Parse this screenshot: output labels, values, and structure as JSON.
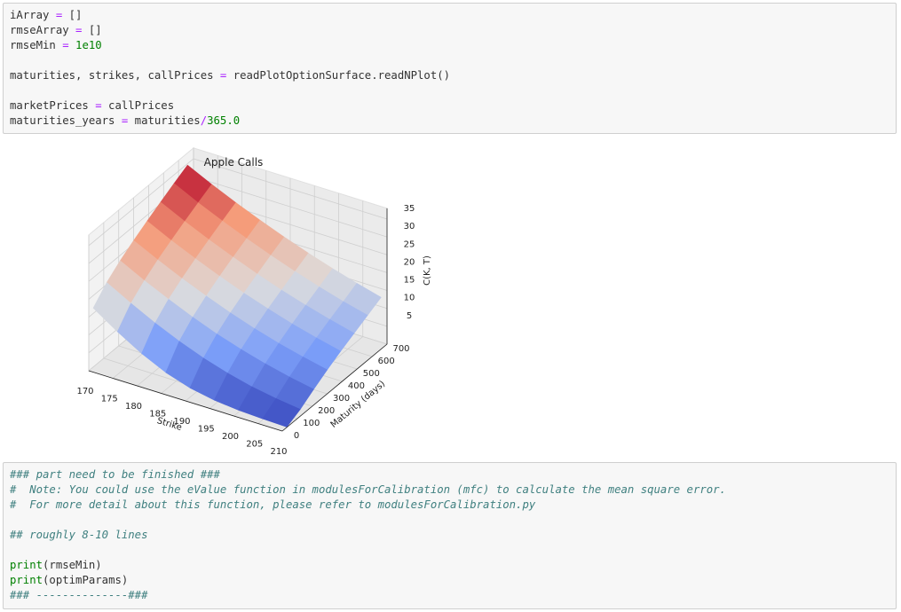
{
  "cells": [
    {
      "lines": [
        [
          [
            "iArray ",
            ""
          ],
          [
            "=",
            "op"
          ],
          [
            " []",
            ""
          ]
        ],
        [
          [
            "rmseArray ",
            ""
          ],
          [
            "=",
            "op"
          ],
          [
            " []",
            ""
          ]
        ],
        [
          [
            "rmseMin ",
            ""
          ],
          [
            "=",
            "op"
          ],
          [
            " ",
            ""
          ],
          [
            "1e10",
            "num"
          ]
        ],
        [],
        [
          [
            "maturities, strikes, callPrices ",
            ""
          ],
          [
            "=",
            "op"
          ],
          [
            " readPlotOptionSurface.readNPlot()",
            ""
          ]
        ],
        [],
        [
          [
            "marketPrices ",
            ""
          ],
          [
            "=",
            "op"
          ],
          [
            " callPrices",
            ""
          ]
        ],
        [
          [
            "maturities_years ",
            ""
          ],
          [
            "=",
            "op"
          ],
          [
            " maturities",
            ""
          ],
          [
            "/",
            "op"
          ],
          [
            "365.0",
            "num"
          ]
        ]
      ]
    },
    {
      "lines": [
        [
          [
            "### part need to be finished ###",
            "cm"
          ]
        ],
        [
          [
            "#  Note: You could use the eValue function in modulesForCalibration (mfc) to calculate the mean square error.",
            "cm"
          ]
        ],
        [
          [
            "#  For more detail about this function, please refer to modulesForCalibration.py",
            "cm"
          ]
        ],
        [],
        [
          [
            "## roughly 8-10 lines",
            "cm"
          ]
        ],
        [],
        [
          [
            "print",
            "bi"
          ],
          [
            "(rmseMin)",
            ""
          ]
        ],
        [
          [
            "print",
            "bi"
          ],
          [
            "(optimParams)",
            ""
          ]
        ],
        [
          [
            "### --------------###",
            "cm"
          ]
        ]
      ]
    }
  ],
  "chart_data": {
    "type": "surface3d",
    "title": "Apple Calls",
    "xlabel": "Strike",
    "ylabel": "Maturity (days)",
    "zlabel": "C(K, T)",
    "colormap": "coolwarm",
    "xlim": [
      170,
      210
    ],
    "ylim": [
      0,
      700
    ],
    "zlim": [
      0,
      38
    ],
    "xticks": [
      "170",
      "175",
      "180",
      "185",
      "190",
      "195",
      "200",
      "205",
      "210"
    ],
    "yticks": [
      "0",
      "100",
      "200",
      "300",
      "400",
      "500",
      "600",
      "700"
    ],
    "zticks": [
      "5",
      "10",
      "15",
      "20",
      "25",
      "30",
      "35"
    ],
    "strikes": [
      170,
      175,
      180,
      185,
      190,
      195,
      200,
      205,
      210
    ],
    "maturities": [
      30,
      120,
      210,
      300,
      390,
      480,
      570,
      660
    ],
    "prices": [
      [
        16.5,
        12.0,
        8.0,
        4.8,
        2.6,
        1.3,
        0.6,
        0.3,
        0.1
      ],
      [
        20.5,
        16.8,
        13.4,
        10.4,
        7.8,
        5.7,
        4.0,
        2.8,
        1.9
      ],
      [
        23.5,
        20.0,
        16.9,
        14.0,
        11.4,
        9.2,
        7.3,
        5.7,
        4.4
      ],
      [
        26.0,
        22.7,
        19.6,
        16.8,
        14.2,
        11.9,
        9.9,
        8.2,
        6.7
      ],
      [
        28.3,
        25.0,
        22.0,
        19.2,
        16.6,
        14.3,
        12.2,
        10.4,
        8.8
      ],
      [
        30.5,
        27.2,
        24.2,
        21.4,
        18.8,
        16.4,
        14.3,
        12.4,
        10.7
      ],
      [
        32.6,
        29.3,
        26.3,
        23.5,
        20.9,
        18.5,
        16.3,
        14.3,
        12.6
      ],
      [
        34.6,
        31.3,
        28.3,
        25.5,
        22.9,
        20.5,
        18.3,
        16.3,
        14.5
      ]
    ]
  }
}
